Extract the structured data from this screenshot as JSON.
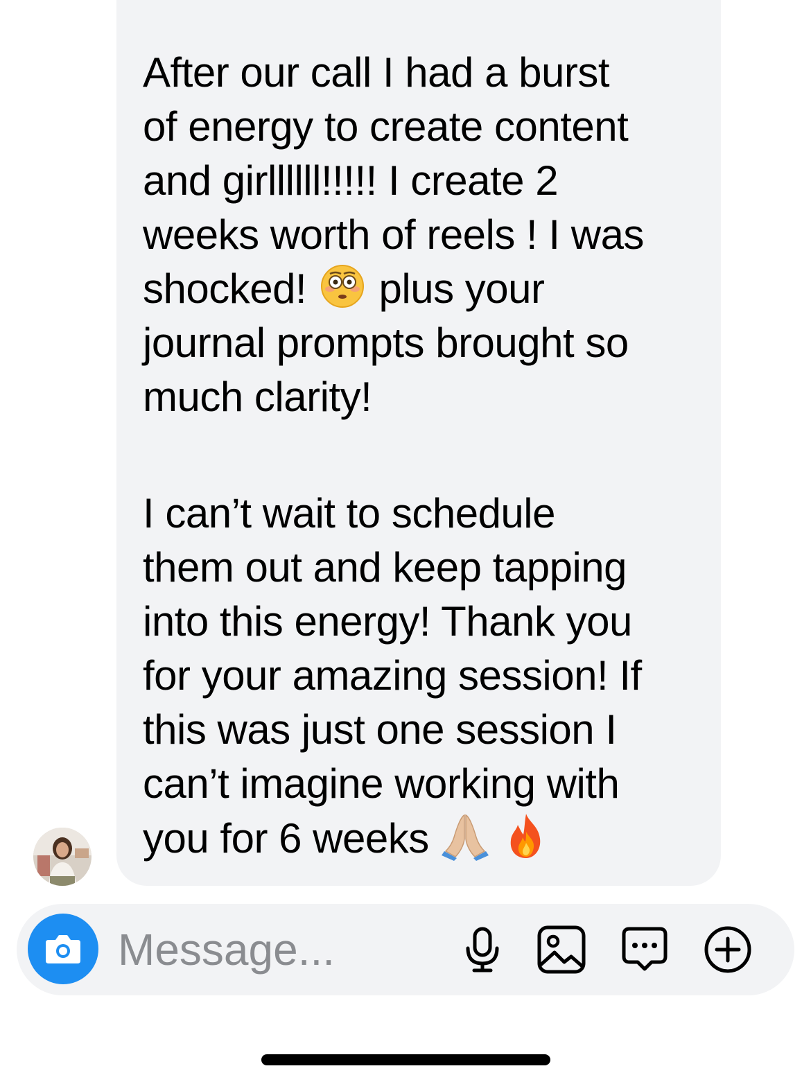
{
  "message": {
    "lines": {
      "l1": "After our call I had a burst",
      "l2": "of energy to create content",
      "l3": "and girllllll!!!!! I create 2",
      "l4": "weeks worth of reels ! I was",
      "l5a": "shocked!",
      "l5b": "plus your",
      "l6": "journal prompts brought so",
      "l7": "much clarity!",
      "l8": "I can’t wait to schedule",
      "l9": "them out and keep tapping",
      "l10": "into this energy! Thank you",
      "l11": "for your amazing session! If",
      "l12": "this was just one session I",
      "l13": "can’t imagine working with",
      "l14": "you for 6 weeks"
    },
    "emojis": {
      "shocked": "flushed-face-emoji",
      "end1": "folded-hands-emoji",
      "end2": "fire-emoji"
    }
  },
  "composer": {
    "placeholder": "Message...",
    "icons": [
      "camera-icon",
      "microphone-icon",
      "gallery-icon",
      "sticker-chat-icon",
      "add-circle-icon"
    ]
  },
  "colors": {
    "bubble": "#f2f3f5",
    "accent": "#1d8ef2",
    "placeholder": "#8a8c90"
  }
}
